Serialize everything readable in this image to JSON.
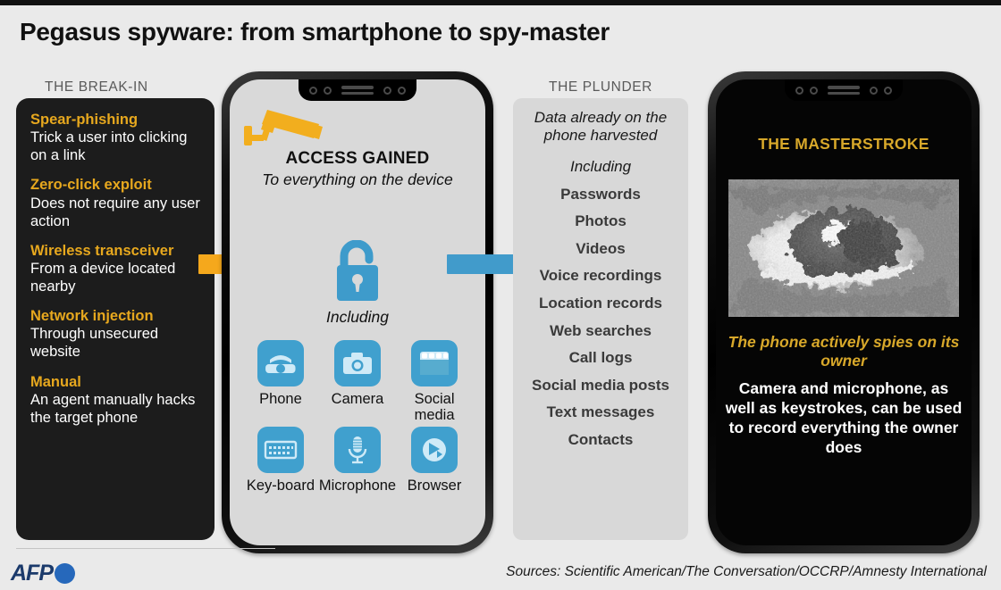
{
  "title": "Pegasus spyware: from smartphone to spy-master",
  "columns": {
    "break_in_heading": "THE BREAK-IN",
    "plunder_heading": "THE PLUNDER"
  },
  "break_in": {
    "items": [
      {
        "heading": "Spear-phishing",
        "body": "Trick a user into clicking on a link"
      },
      {
        "heading": "Zero-click exploit",
        "body": "Does not require any user action"
      },
      {
        "heading": "Wireless transceiver",
        "body": "From a device located nearby"
      },
      {
        "heading": "Network injection",
        "body": "Through unsecured website"
      },
      {
        "heading": "Manual",
        "body": "An agent manually hacks the target phone"
      }
    ]
  },
  "center_phone": {
    "cctv_icon": "cctv-camera-icon",
    "access_title": "ACCESS GAINED",
    "access_subtitle": "To everything on the device",
    "lock_icon": "open-padlock-icon",
    "including_label": "Including",
    "apps": [
      {
        "label": "Phone",
        "icon": "phone-icon"
      },
      {
        "label": "Camera",
        "icon": "camera-icon"
      },
      {
        "label": "Social media",
        "icon": "social-media-icon"
      },
      {
        "label": "Key-board",
        "icon": "keyboard-icon"
      },
      {
        "label": "Microphone",
        "icon": "microphone-icon"
      },
      {
        "label": "Browser",
        "icon": "browser-icon"
      }
    ]
  },
  "plunder": {
    "intro": "Data already on the phone harvested",
    "including_label": "Including",
    "items": [
      "Passwords",
      "Photos",
      "Videos",
      "Voice recordings",
      "Location records",
      "Web searches",
      "Call logs",
      "Social media posts",
      "Text messages",
      "Contacts"
    ]
  },
  "right_phone": {
    "title": "THE MASTERSTROKE",
    "image_alt": "grainy-black-and-white-close-up-of-an-eye",
    "subtitle": "The phone actively spies on its owner",
    "body": "Camera and microphone, as well as keystrokes, can be used to record everything the owner does"
  },
  "footer": {
    "logo_text": "AFP",
    "sources": "Sources: Scientific  American/The Conversation/OCCRP/Amnesty International"
  },
  "colors": {
    "gold": "#E7A81E",
    "arrow_gold": "#F5A81C",
    "arrow_blue": "#419BCB",
    "app_tile_blue": "#40A0CE",
    "panel_black": "#1C1C1C",
    "plunder_grey": "#D8D8D8",
    "page_bg": "#EAEAEA",
    "afp_blue": "#2668BB"
  }
}
